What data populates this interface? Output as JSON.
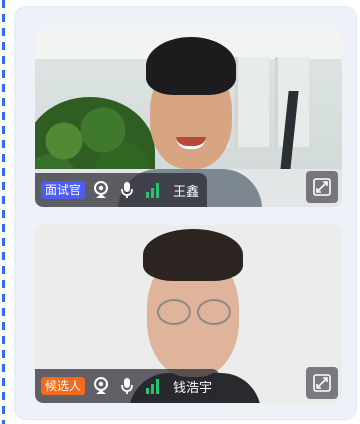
{
  "participants": [
    {
      "role_label": "面试官",
      "role_color": "#4c5ef2",
      "name": "王鑫",
      "camera_icon": "webcam-icon",
      "mic_icon": "microphone-icon",
      "signal_icon": "signal-strength-icon",
      "expand_icon": "expand-fullscreen-icon"
    },
    {
      "role_label": "候选人",
      "role_color": "#f26a1b",
      "name": "钱浩宇",
      "camera_icon": "webcam-icon",
      "mic_icon": "microphone-icon",
      "signal_icon": "signal-strength-icon",
      "expand_icon": "expand-fullscreen-icon"
    }
  ],
  "colors": {
    "signal_green": "#1fc96b",
    "panel_bg": "#eef2f8",
    "accent_blue": "#2f6bff"
  }
}
